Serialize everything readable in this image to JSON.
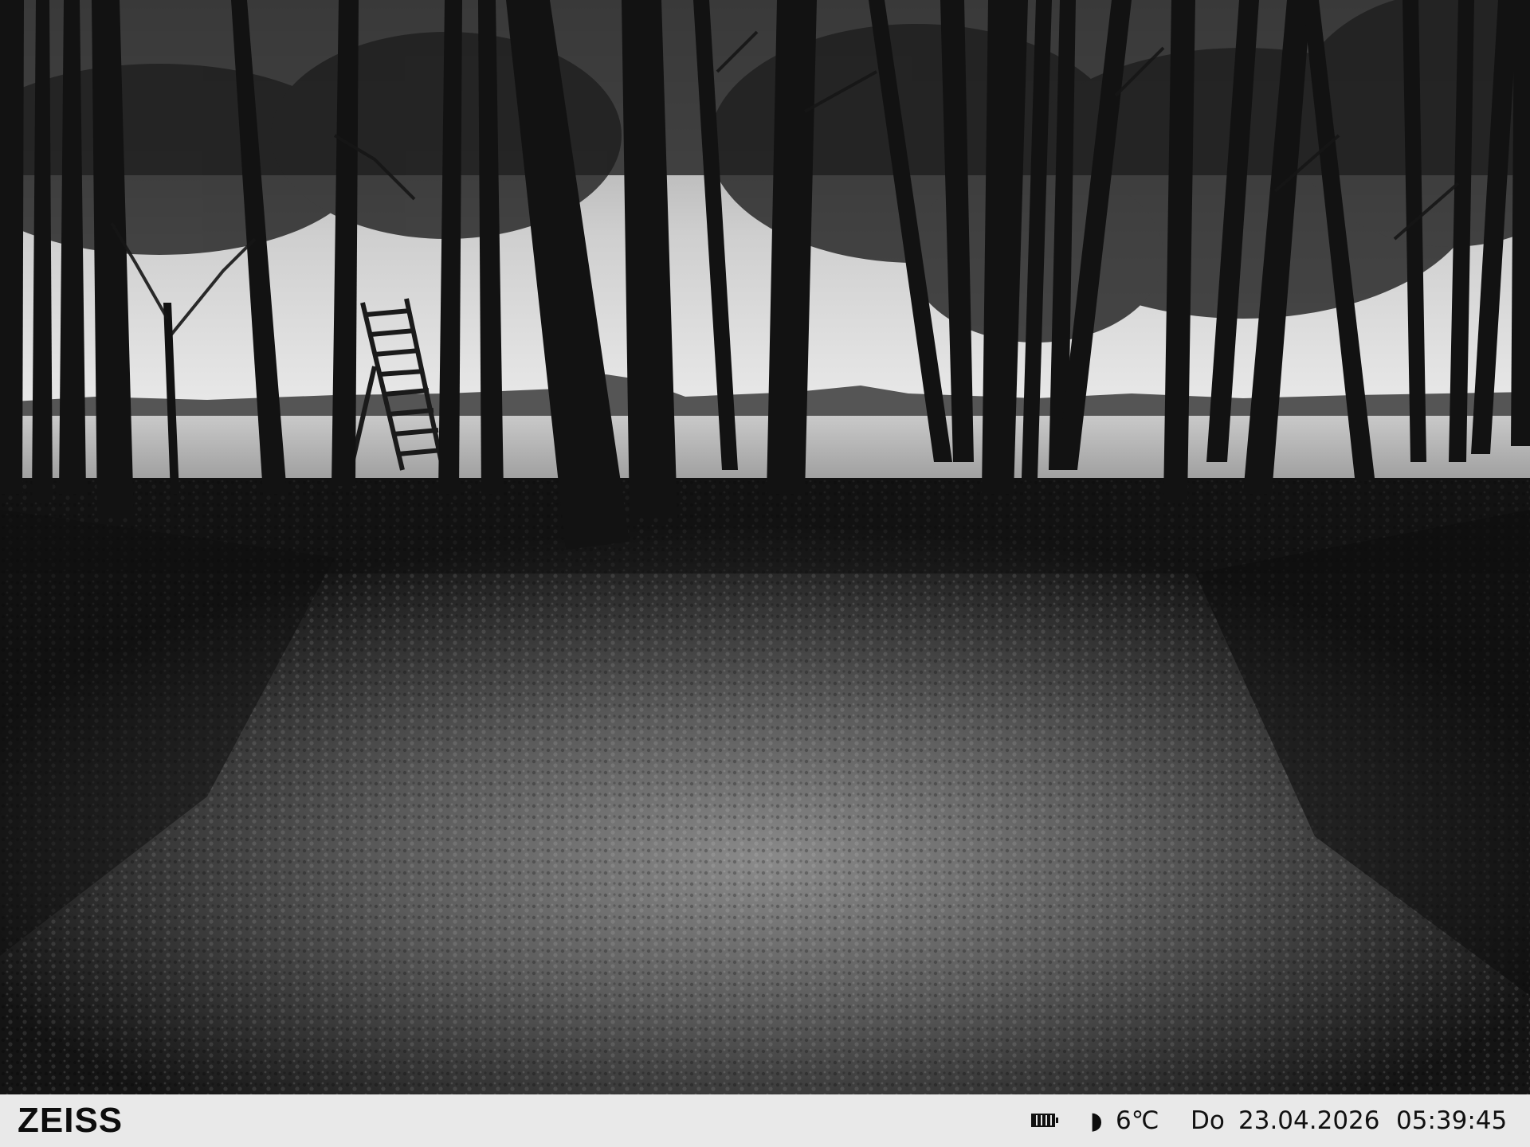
{
  "image": {
    "description_colors": {
      "sky": "#d9d9d9",
      "field": "#bcbcbc",
      "ground_lit": "#6f6f6f",
      "ground_dark": "#1c1c1c",
      "trees": "#151515",
      "info_bar": "#e9e9e9"
    }
  },
  "info_bar": {
    "brand": "ZEISS",
    "battery_icon": "battery-icon",
    "moon_icon": "moon-phase-icon",
    "moon_glyph": "◗",
    "temperature": "6℃",
    "weekday": "Do",
    "date": "23.04.2026",
    "time": "05:39:45"
  }
}
